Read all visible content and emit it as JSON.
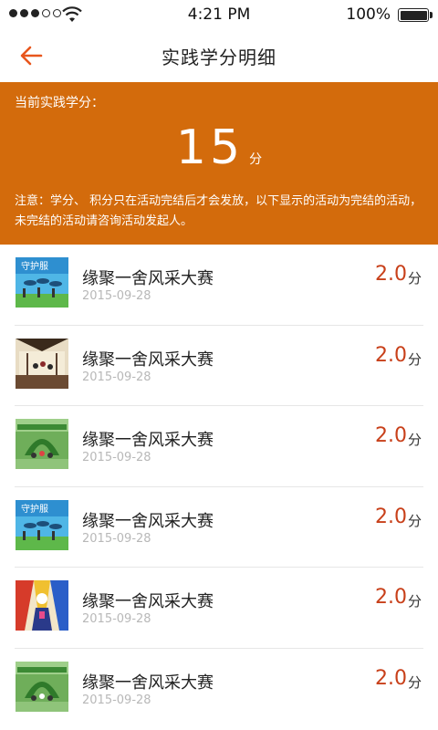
{
  "status_bar": {
    "time": "4:21 PM",
    "battery": "100%",
    "signal_bars_filled": 3,
    "signal_bars_total": 5
  },
  "nav": {
    "title": "实践学分明细",
    "back_icon": "arrow-left-icon",
    "accent_color": "#e8561c"
  },
  "summary": {
    "label": "当前实践学分：",
    "score": "15",
    "unit": "分",
    "note": "注意：学分、 积分只在活动完结后才会发放，以下显示的活动为完结的活动，未完结的活动请咨询活动发起人。",
    "background_color": "#d36b0c"
  },
  "activities": [
    {
      "title": "缘聚一舍风采大赛",
      "date": "2015-09-28",
      "score": "2.0",
      "unit": "分",
      "thumbnail": "sky-poster"
    },
    {
      "title": "缘聚一舍风采大赛",
      "date": "2015-09-28",
      "score": "2.0",
      "unit": "分",
      "thumbnail": "hall-performance"
    },
    {
      "title": "缘聚一舍风采大赛",
      "date": "2015-09-28",
      "score": "2.0",
      "unit": "分",
      "thumbnail": "green-arch"
    },
    {
      "title": "缘聚一舍风采大赛",
      "date": "2015-09-28",
      "score": "2.0",
      "unit": "分",
      "thumbnail": "sky-poster"
    },
    {
      "title": "缘聚一舍风采大赛",
      "date": "2015-09-28",
      "score": "2.0",
      "unit": "分",
      "thumbnail": "colorful-stage"
    },
    {
      "title": "缘聚一舍风采大赛",
      "date": "2015-09-28",
      "score": "2.0",
      "unit": "分",
      "thumbnail": "green-arch"
    }
  ]
}
